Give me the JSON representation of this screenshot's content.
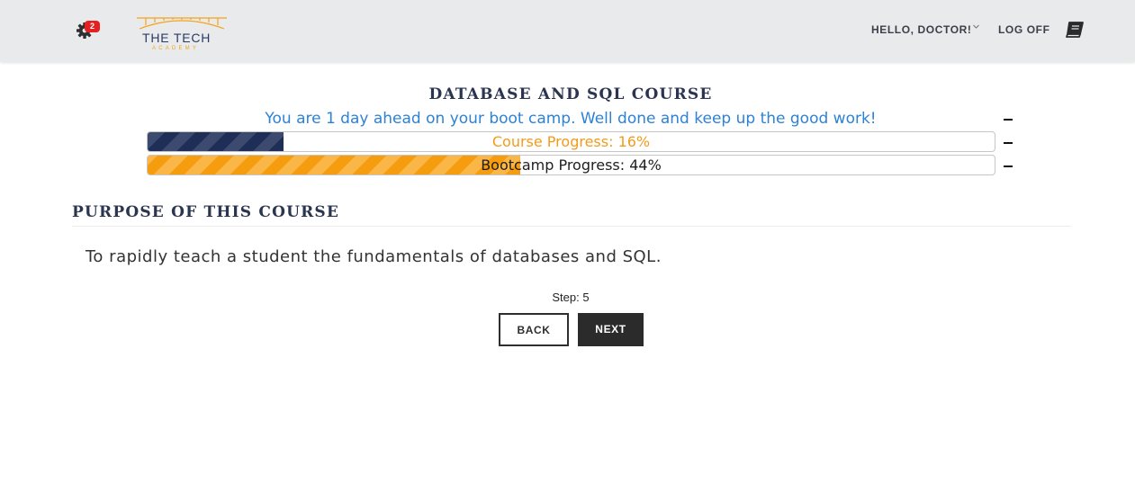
{
  "header": {
    "notification_count": "2",
    "logo": {
      "title": "THE TECH",
      "subtitle": "ACADEMY"
    },
    "user_menu_label": "HELLO, DOCTOR!",
    "logoff_label": "LOG OFF",
    "icons": [
      "gear-icon",
      "notification-badge",
      "chevron-down-icon",
      "book-icon"
    ]
  },
  "course": {
    "title": "DATABASE AND SQL COURSE",
    "status_message": "You are 1 day ahead on your boot camp. Well done and keep up the good work!",
    "course_progress": {
      "label": "Course Progress: 16%",
      "percent": 16
    },
    "bootcamp_progress": {
      "label": "Bootcamp Progress: 44%",
      "percent": 44
    },
    "collapse_symbol": "–"
  },
  "section": {
    "title": "PURPOSE OF THIS COURSE",
    "body": "To rapidly teach a student the fundamentals of databases and SQL."
  },
  "navigation": {
    "step_label": "Step: 5",
    "back_label": "BACK",
    "next_label": "NEXT"
  },
  "colors": {
    "header_bg": "#e9eaec",
    "navy": "#1f2e57",
    "orange": "#f59d0f",
    "link_blue": "#2e82d6",
    "badge_red": "#e52020"
  }
}
